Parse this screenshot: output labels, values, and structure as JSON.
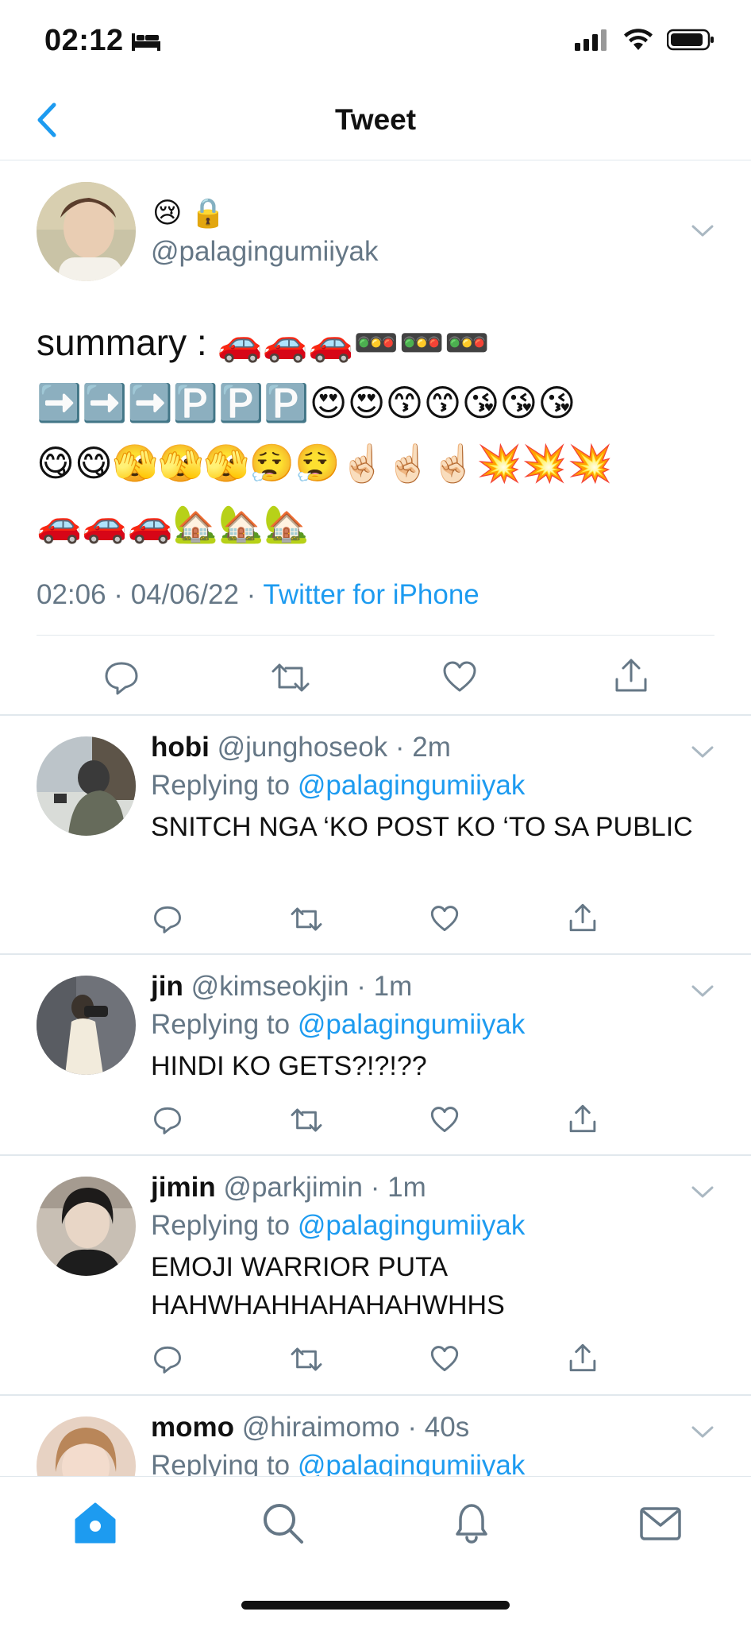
{
  "status_bar": {
    "time": "02:12"
  },
  "nav": {
    "title": "Tweet"
  },
  "main_tweet": {
    "display_name": "😢 🔒",
    "handle": "@palagingumiiyak",
    "text_line1": "summary : 🚗🚗🚗🚥🚥🚥",
    "text_line2": "➡️➡️➡️🅿️🅿️🅿️😍😍😙😙😘😘😘",
    "text_line3": "😋😋🫣🫣🫣😮‍💨😮‍💨☝🏻☝🏻☝🏻💥💥💥",
    "text_line4": "🚗🚗🚗🏡🏡🏡",
    "timestamp": "02:06 · 04/06/22 · ",
    "source": "Twitter for iPhone"
  },
  "replies": [
    {
      "name": "hobi",
      "handle": "@junghoseok",
      "time": "· 2m",
      "replying_label": "Replying to ",
      "replying_to": "@palagingumiiyak",
      "text": "SNITCH NGA ‘KO POST KO ‘TO SA PUBLIC"
    },
    {
      "name": "jin",
      "handle": "@kimseokjin",
      "time": "· 1m",
      "replying_label": "Replying to ",
      "replying_to": "@palagingumiiyak",
      "text": "HINDI KO GETS?!?!??"
    },
    {
      "name": "jimin",
      "handle": "@parkjimin",
      "time": "· 1m",
      "replying_label": "Replying to ",
      "replying_to": "@palagingumiiyak",
      "text": "EMOJI WARRIOR PUTA HAHWHAHHAHAHAHWHHS"
    },
    {
      "name": "momo",
      "handle": "@hiraimomo",
      "time": "· 40s",
      "replying_label": "Replying to ",
      "replying_to": "@palagingumiiyak",
      "text": ""
    }
  ],
  "icons": {
    "reply": "reply-icon",
    "retweet": "retweet-icon",
    "like": "heart-icon",
    "share": "share-icon",
    "home": "home-icon",
    "search": "search-icon",
    "notifications": "bell-icon",
    "messages": "mail-icon"
  },
  "colors": {
    "accent": "#1d9bf0",
    "muted": "#657786",
    "divider": "#e1e8ed"
  }
}
